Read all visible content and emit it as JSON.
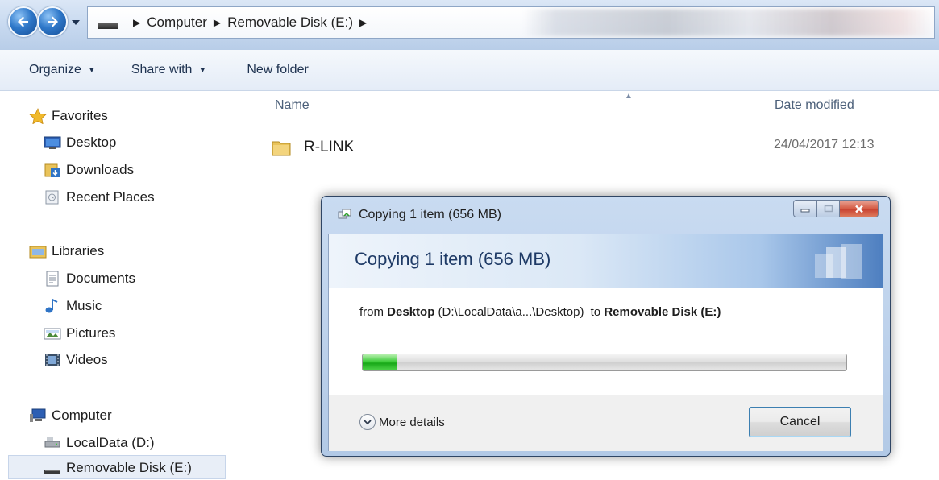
{
  "address_bar": {
    "breadcrumbs": [
      "Computer",
      "Removable Disk (E:)"
    ]
  },
  "toolbar": {
    "organize_label": "Organize",
    "share_label": "Share with",
    "new_folder_label": "New folder"
  },
  "nav": {
    "favorites": {
      "label": "Favorites",
      "items": [
        "Desktop",
        "Downloads",
        "Recent Places"
      ]
    },
    "libraries": {
      "label": "Libraries",
      "items": [
        "Documents",
        "Music",
        "Pictures",
        "Videos"
      ]
    },
    "computer": {
      "label": "Computer",
      "items": [
        "LocalData (D:)",
        "Removable Disk (E:)"
      ]
    }
  },
  "file_list": {
    "columns": {
      "name": "Name",
      "date_modified": "Date modified"
    },
    "rows": [
      {
        "name": "R-LINK",
        "date_modified": "24/04/2017 12:13"
      }
    ]
  },
  "dialog": {
    "window_title": "Copying 1 item (656 MB)",
    "header_title": "Copying 1 item (656 MB)",
    "from_word": "from",
    "source_name": "Desktop",
    "source_path": "(D:\\LocalData\\a...\\Desktop)",
    "to_word": "to",
    "destination_name": "Removable Disk (E:)",
    "progress_fraction": 0.07,
    "more_details_label": "More details",
    "cancel_label": "Cancel"
  },
  "colors": {
    "titlebar": "#c6d8ef",
    "progress_green": "#18a818",
    "close_red": "#c8402f"
  }
}
